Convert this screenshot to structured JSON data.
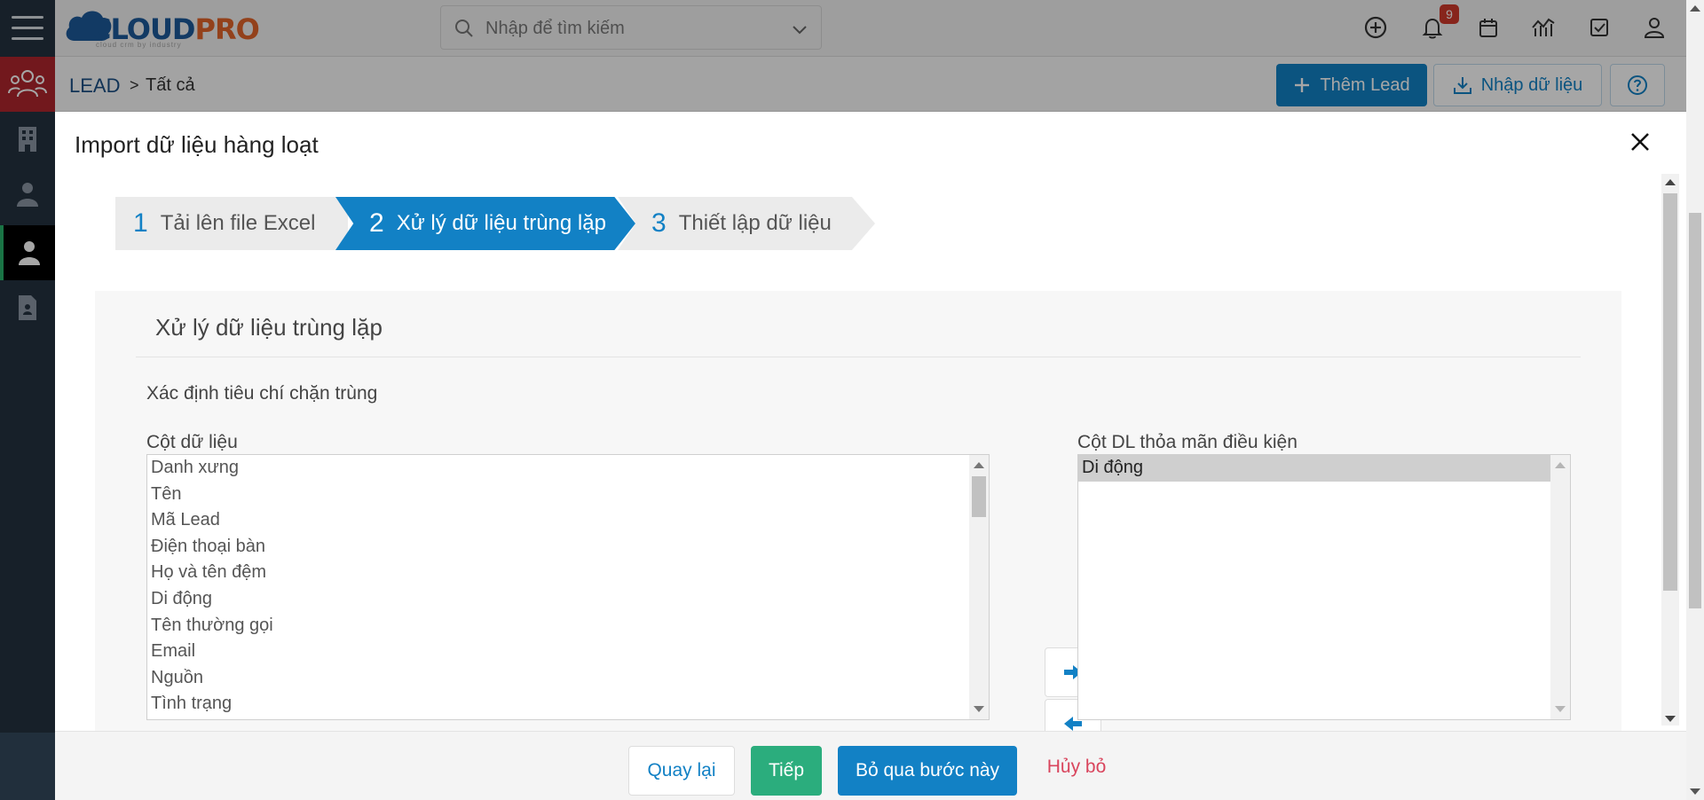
{
  "header": {
    "logo_main": "CLOUD",
    "logo_accent": "PRO",
    "logo_tagline": "cloud crm by industry",
    "search_placeholder": "Nhập để tìm kiếm",
    "notification_count": "9"
  },
  "breadcrumb": {
    "root": "LEAD",
    "separator": ">",
    "current": "Tất cả"
  },
  "actions": {
    "add_lead": "Thêm Lead",
    "import_data": "Nhập dữ liệu"
  },
  "modal": {
    "title": "Import dữ liệu hàng loạt",
    "steps": [
      {
        "num": "1",
        "label": "Tải lên file Excel"
      },
      {
        "num": "2",
        "label": "Xử lý dữ liệu trùng lặp"
      },
      {
        "num": "3",
        "label": "Thiết lập dữ liệu"
      }
    ],
    "active_step": 2,
    "section_title": "Xử lý dữ liệu trùng lặp",
    "criteria_label": "Xác định tiêu chí chặn trùng",
    "left_column_label": "Cột dữ liệu",
    "right_column_label": "Cột DL thỏa mãn điều kiện",
    "available_columns": [
      "Danh xưng",
      "Tên",
      "Mã Lead",
      "Điện thoại bàn",
      "Họ và tên đệm",
      "Di động",
      "Tên thường gọi",
      "Email",
      "Nguồn",
      "Tình trạng"
    ],
    "selected_columns": [
      "Di động"
    ],
    "footer": {
      "back": "Quay lại",
      "next": "Tiếp",
      "skip": "Bỏ qua bước này",
      "cancel": "Hủy bỏ"
    }
  },
  "colors": {
    "primary": "#1281c5",
    "success": "#2bad7d",
    "danger": "#d9455d",
    "nav_bg": "#243240",
    "nav_active_red": "#b0262d",
    "logo_blue": "#1c5a9a",
    "logo_orange": "#e2652a"
  }
}
